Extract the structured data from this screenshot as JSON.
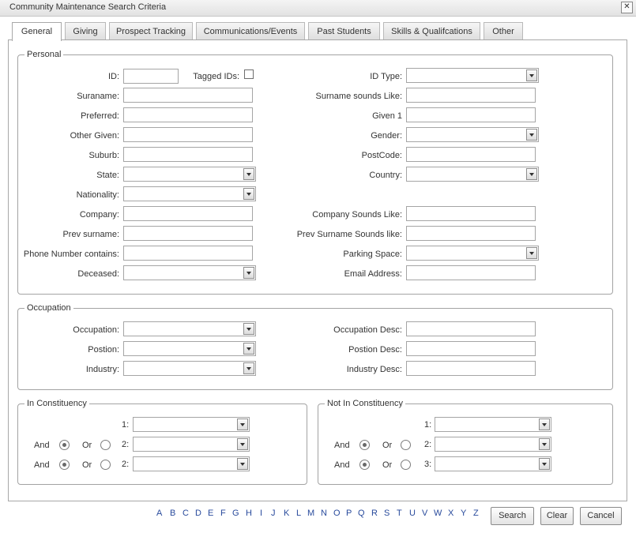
{
  "window": {
    "title": "Community Maintenance Search Criteria",
    "close_glyph": "✕"
  },
  "tabs": [
    "General",
    "Giving",
    "Prospect Tracking",
    "Communications/Events",
    "Past Students",
    "Skills & Qualifcations",
    "Other"
  ],
  "personal": {
    "legend": "Personal",
    "id_label": "ID:",
    "tagged_label": "Tagged IDs:",
    "id_type_label": "ID Type:",
    "surname_label": "Suraname:",
    "surname_sounds_label": "Surname sounds Like:",
    "preferred_label": "Preferred:",
    "given1_label": "Given 1",
    "other_given_label": "Other Given:",
    "gender_label": "Gender:",
    "suburb_label": "Suburb:",
    "postcode_label": "PostCode:",
    "state_label": "State:",
    "country_label": "Country:",
    "nationality_label": "Nationality:",
    "company_label": "Company:",
    "company_sounds_label": "Company Sounds Like:",
    "prev_surname_label": "Prev surname:",
    "prev_surname_sounds_label": "Prev Surname Sounds like:",
    "phone_label": "Phone Number contains:",
    "parking_label": "Parking Space:",
    "deceased_label": "Deceased:",
    "email_label": "Email Address:"
  },
  "occupation": {
    "legend": "Occupation",
    "occupation_label": "Occupation:",
    "occupation_desc_label": "Occupation Desc:",
    "position_label": "Postion:",
    "position_desc_label": "Postion Desc:",
    "industry_label": "Industry:",
    "industry_desc_label": "Industry Desc:"
  },
  "in_constituency": {
    "legend": "In Constituency",
    "and_label": "And",
    "or_label": "Or",
    "row1_num": "1:",
    "row2_num": "2:",
    "row3_num": "2:"
  },
  "not_in_constituency": {
    "legend": "Not In Constituency",
    "and_label": "And",
    "or_label": "Or",
    "row1_num": "1:",
    "row2_num": "2:",
    "row3_num": "3:"
  },
  "alphabet": [
    "A",
    "B",
    "C",
    "D",
    "E",
    "F",
    "G",
    "H",
    "I",
    "J",
    "K",
    "L",
    "M",
    "N",
    "O",
    "P",
    "Q",
    "R",
    "S",
    "T",
    "U",
    "V",
    "W",
    "X",
    "Y",
    "Z"
  ],
  "buttons": {
    "search": "Search",
    "clear": "Clear",
    "cancel": "Cancel"
  }
}
